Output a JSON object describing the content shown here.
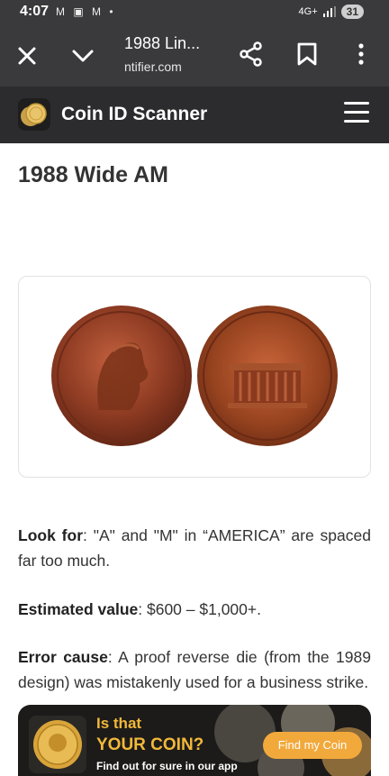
{
  "status_bar": {
    "time": "4:07",
    "notification_icons": "M ▣ M •",
    "network": "4G+",
    "battery": "31"
  },
  "toolbar": {
    "title": "1988 Lin...",
    "url": "ntifier.com"
  },
  "site": {
    "name": "Coin ID Scanner"
  },
  "article": {
    "title": "1988 Wide AM",
    "image_alt": "1988 Lincoln cent obverse and reverse",
    "look_for_label": "Look for",
    "look_for_text": ": \"A\" and \"M\" in “AMERICA” are spaced far too much.",
    "estimated_label": "Estimated value",
    "estimated_text": ": $600 – $1,000+.",
    "error_label": "Error cause",
    "error_text": ": A proof reverse die (from the 1989 design) was mistakenly used for a business strike."
  },
  "ad": {
    "line1": "Is that",
    "line2": "YOUR COIN?",
    "line3": "Find out for sure in our app",
    "button": "Find my Coin"
  },
  "colors": {
    "toolbar_bg": "#3a3a3c",
    "header_bg": "#2c2c2e",
    "ad_accent": "#f2b83a"
  }
}
